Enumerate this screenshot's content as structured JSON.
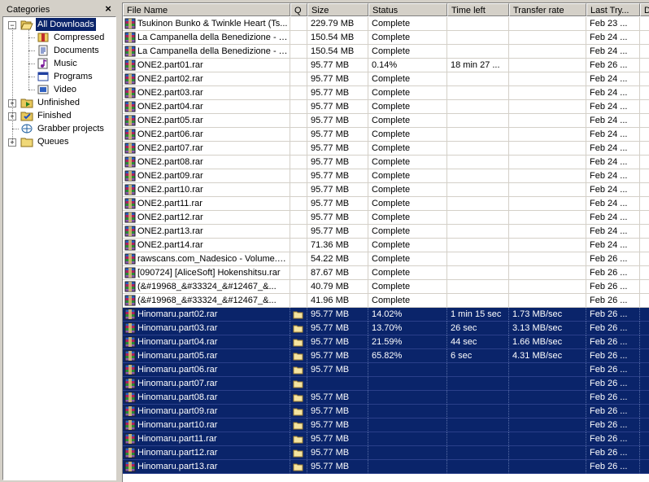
{
  "categories_panel": {
    "title": "Categories",
    "close_glyph": "×",
    "tree": [
      {
        "label": "All Downloads",
        "icon": "folder-open-icon",
        "expander": "−",
        "selected": true,
        "level": 0
      },
      {
        "label": "Compressed",
        "icon": "compressed-icon",
        "level": 1
      },
      {
        "label": "Documents",
        "icon": "documents-icon",
        "level": 1
      },
      {
        "label": "Music",
        "icon": "music-icon",
        "level": 1
      },
      {
        "label": "Programs",
        "icon": "programs-icon",
        "level": 1
      },
      {
        "label": "Video",
        "icon": "video-icon",
        "level": 1
      },
      {
        "label": "Unfinished",
        "icon": "unfinished-folder-icon",
        "expander": "+",
        "level": 0
      },
      {
        "label": "Finished",
        "icon": "finished-folder-icon",
        "expander": "+",
        "level": 0
      },
      {
        "label": "Grabber projects",
        "icon": "grabber-icon",
        "level": 0
      },
      {
        "label": "Queues",
        "icon": "queues-folder-icon",
        "expander": "+",
        "level": 0
      }
    ]
  },
  "download_list": {
    "columns": [
      "File Name",
      "Q",
      "Size",
      "Status",
      "Time left",
      "Transfer rate",
      "Last Try...",
      "D"
    ],
    "selection_color": "#0a246a",
    "rows": [
      {
        "name": "Tsukinon Bunko & Twinkle Heart (Ts...",
        "q": "",
        "size": "229.79  MB",
        "status": "Complete",
        "time_left": "",
        "rate": "",
        "last": "Feb 23 ...",
        "selected": false
      },
      {
        "name": "La Campanella della Benedizione - T...",
        "q": "",
        "size": "150.54  MB",
        "status": "Complete",
        "time_left": "",
        "rate": "",
        "last": "Feb 24 ...",
        "selected": false
      },
      {
        "name": "La Campanella della Benedizione - T...",
        "q": "",
        "size": "150.54  MB",
        "status": "Complete",
        "time_left": "",
        "rate": "",
        "last": "Feb 24 ...",
        "selected": false
      },
      {
        "name": "ONE2.part01.rar",
        "q": "",
        "size": "95.77  MB",
        "status": "0.14%",
        "time_left": "18 min 27 ...",
        "rate": "",
        "last": "Feb 26 ...",
        "selected": false
      },
      {
        "name": "ONE2.part02.rar",
        "q": "",
        "size": "95.77  MB",
        "status": "Complete",
        "time_left": "",
        "rate": "",
        "last": "Feb 24 ...",
        "selected": false
      },
      {
        "name": "ONE2.part03.rar",
        "q": "",
        "size": "95.77  MB",
        "status": "Complete",
        "time_left": "",
        "rate": "",
        "last": "Feb 24 ...",
        "selected": false
      },
      {
        "name": "ONE2.part04.rar",
        "q": "",
        "size": "95.77  MB",
        "status": "Complete",
        "time_left": "",
        "rate": "",
        "last": "Feb 24 ...",
        "selected": false
      },
      {
        "name": "ONE2.part05.rar",
        "q": "",
        "size": "95.77  MB",
        "status": "Complete",
        "time_left": "",
        "rate": "",
        "last": "Feb 24 ...",
        "selected": false
      },
      {
        "name": "ONE2.part06.rar",
        "q": "",
        "size": "95.77  MB",
        "status": "Complete",
        "time_left": "",
        "rate": "",
        "last": "Feb 24 ...",
        "selected": false
      },
      {
        "name": "ONE2.part07.rar",
        "q": "",
        "size": "95.77  MB",
        "status": "Complete",
        "time_left": "",
        "rate": "",
        "last": "Feb 24 ...",
        "selected": false
      },
      {
        "name": "ONE2.part08.rar",
        "q": "",
        "size": "95.77  MB",
        "status": "Complete",
        "time_left": "",
        "rate": "",
        "last": "Feb 24 ...",
        "selected": false
      },
      {
        "name": "ONE2.part09.rar",
        "q": "",
        "size": "95.77  MB",
        "status": "Complete",
        "time_left": "",
        "rate": "",
        "last": "Feb 24 ...",
        "selected": false
      },
      {
        "name": "ONE2.part10.rar",
        "q": "",
        "size": "95.77  MB",
        "status": "Complete",
        "time_left": "",
        "rate": "",
        "last": "Feb 24 ...",
        "selected": false
      },
      {
        "name": "ONE2.part11.rar",
        "q": "",
        "size": "95.77  MB",
        "status": "Complete",
        "time_left": "",
        "rate": "",
        "last": "Feb 24 ...",
        "selected": false
      },
      {
        "name": "ONE2.part12.rar",
        "q": "",
        "size": "95.77  MB",
        "status": "Complete",
        "time_left": "",
        "rate": "",
        "last": "Feb 24 ...",
        "selected": false
      },
      {
        "name": "ONE2.part13.rar",
        "q": "",
        "size": "95.77  MB",
        "status": "Complete",
        "time_left": "",
        "rate": "",
        "last": "Feb 24 ...",
        "selected": false
      },
      {
        "name": "ONE2.part14.rar",
        "q": "",
        "size": "71.36  MB",
        "status": "Complete",
        "time_left": "",
        "rate": "",
        "last": "Feb 24 ...",
        "selected": false
      },
      {
        "name": "rawscans.com_Nadesico - Volume.0...",
        "q": "",
        "size": "54.22  MB",
        "status": "Complete",
        "time_left": "",
        "rate": "",
        "last": "Feb 26 ...",
        "selected": false
      },
      {
        "name": "[090724] [AliceSoft] Hokenshitsu.rar",
        "q": "",
        "size": "87.67  MB",
        "status": "Complete",
        "time_left": "",
        "rate": "",
        "last": "Feb 26 ...",
        "selected": false
      },
      {
        "name": "(&#19968_&#33324_&#12467_&...",
        "q": "",
        "size": "40.79  MB",
        "status": "Complete",
        "time_left": "",
        "rate": "",
        "last": "Feb 26 ...",
        "selected": false
      },
      {
        "name": "(&#19968_&#33324_&#12467_&...",
        "q": "",
        "size": "41.96  MB",
        "status": "Complete",
        "time_left": "",
        "rate": "",
        "last": "Feb 26 ...",
        "selected": false
      },
      {
        "name": "Hinomaru.part02.rar",
        "q": "queue",
        "size": "95.77  MB",
        "status": "14.02%",
        "time_left": "1 min 15 sec",
        "rate": "1.73  MB/sec",
        "last": "Feb 26 ...",
        "selected": true
      },
      {
        "name": "Hinomaru.part03.rar",
        "q": "queue",
        "size": "95.77  MB",
        "status": "13.70%",
        "time_left": "26 sec",
        "rate": "3.13  MB/sec",
        "last": "Feb 26 ...",
        "selected": true
      },
      {
        "name": "Hinomaru.part04.rar",
        "q": "queue",
        "size": "95.77  MB",
        "status": "21.59%",
        "time_left": "44 sec",
        "rate": "1.66  MB/sec",
        "last": "Feb 26 ...",
        "selected": true
      },
      {
        "name": "Hinomaru.part05.rar",
        "q": "queue",
        "size": "95.77  MB",
        "status": "65.82%",
        "time_left": "6 sec",
        "rate": "4.31  MB/sec",
        "last": "Feb 26 ...",
        "selected": true
      },
      {
        "name": "Hinomaru.part06.rar",
        "q": "queue",
        "size": "95.77  MB",
        "status": "",
        "time_left": "",
        "rate": "",
        "last": "Feb 26 ...",
        "selected": true
      },
      {
        "name": "Hinomaru.part07.rar",
        "q": "queue",
        "size": "",
        "status": "",
        "time_left": "",
        "rate": "",
        "last": "Feb 26 ...",
        "selected": true
      },
      {
        "name": "Hinomaru.part08.rar",
        "q": "queue",
        "size": "95.77  MB",
        "status": "",
        "time_left": "",
        "rate": "",
        "last": "Feb 26 ...",
        "selected": true
      },
      {
        "name": "Hinomaru.part09.rar",
        "q": "queue",
        "size": "95.77  MB",
        "status": "",
        "time_left": "",
        "rate": "",
        "last": "Feb 26 ...",
        "selected": true
      },
      {
        "name": "Hinomaru.part10.rar",
        "q": "queue",
        "size": "95.77  MB",
        "status": "",
        "time_left": "",
        "rate": "",
        "last": "Feb 26 ...",
        "selected": true
      },
      {
        "name": "Hinomaru.part11.rar",
        "q": "queue",
        "size": "95.77  MB",
        "status": "",
        "time_left": "",
        "rate": "",
        "last": "Feb 26 ...",
        "selected": true
      },
      {
        "name": "Hinomaru.part12.rar",
        "q": "queue",
        "size": "95.77  MB",
        "status": "",
        "time_left": "",
        "rate": "",
        "last": "Feb 26 ...",
        "selected": true
      },
      {
        "name": "Hinomaru.part13.rar",
        "q": "queue",
        "size": "95.77  MB",
        "status": "",
        "time_left": "",
        "rate": "",
        "last": "Feb 26 ...",
        "selected": true
      }
    ]
  }
}
